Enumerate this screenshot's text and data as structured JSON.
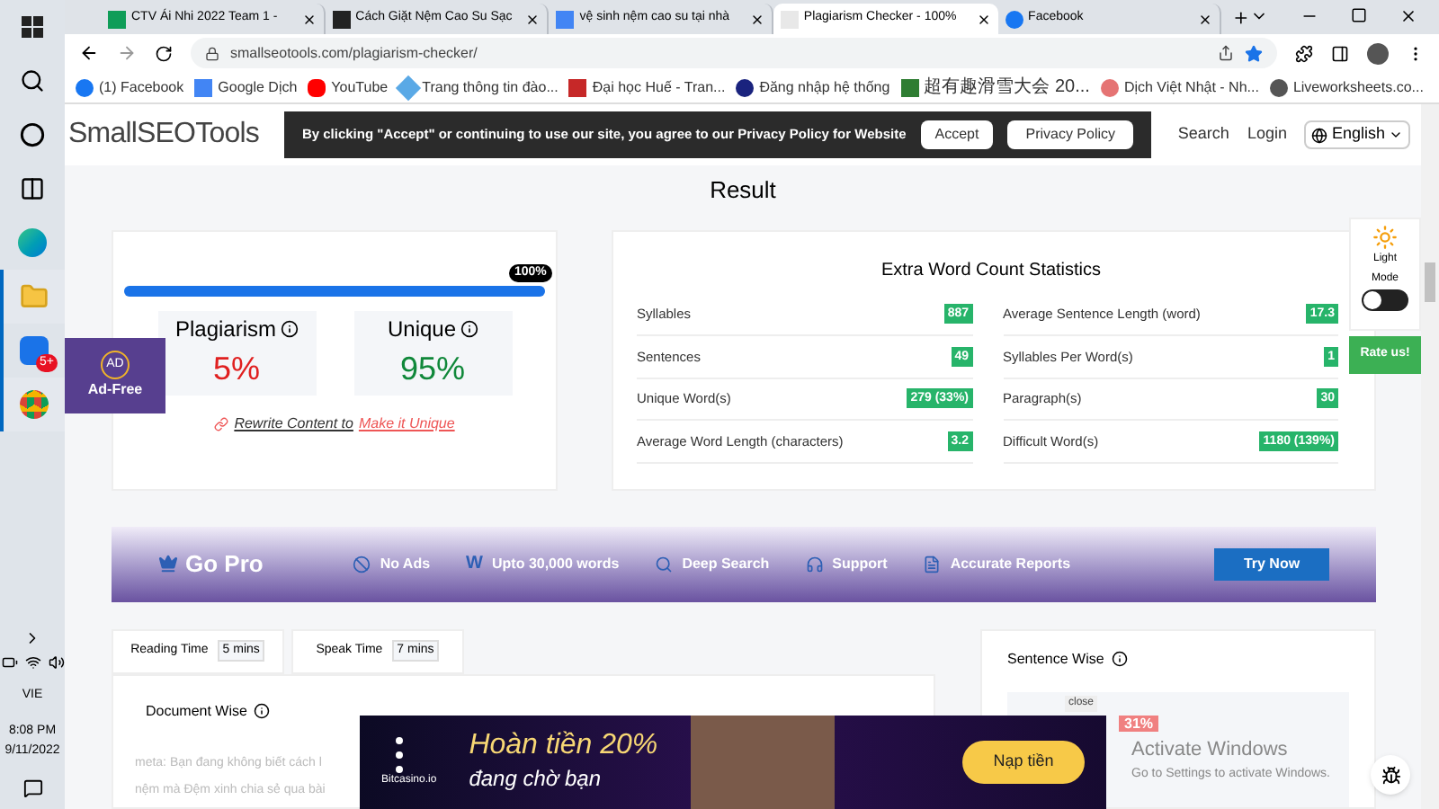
{
  "taskbar": {
    "badge": "5+",
    "language": "VIE",
    "time": "8:08 PM",
    "date": "9/11/2022"
  },
  "tabs": [
    {
      "title": "CTV Ái Nhi 2022 Team 1 -",
      "kind": "sheets",
      "selected": false
    },
    {
      "title": "Cách Giặt Nệm Cao Su Sạc",
      "kind": "dark",
      "selected": false
    },
    {
      "title": "vệ sinh nệm cao su tại nhà",
      "kind": "docs",
      "selected": false
    },
    {
      "title": "Plagiarism Checker - 100%",
      "kind": "sst",
      "selected": true
    },
    {
      "title": "Facebook",
      "kind": "facebook",
      "selected": false
    }
  ],
  "address": "smallseotools.com/plagiarism-checker/",
  "bookmarks": [
    {
      "label": "(1) Facebook",
      "kind": "facebook"
    },
    {
      "label": "Google Dịch",
      "kind": "translate"
    },
    {
      "label": "YouTube",
      "kind": "youtube"
    },
    {
      "label": "Trang thông tin đào...",
      "kind": "diamond"
    },
    {
      "label": "Đại học Huế - Tran...",
      "kind": "shield"
    },
    {
      "label": "Đăng nhập hệ thống",
      "kind": "b"
    },
    {
      "label": "超有趣滑雪大会 20...",
      "kind": "green"
    },
    {
      "label": "Dịch Việt Nhật - Nh...",
      "kind": "search"
    },
    {
      "label": "Liveworksheets.co...",
      "kind": "globe"
    }
  ],
  "site_header": {
    "logo": "SmallSEOTools",
    "links": [
      "Search",
      "Login"
    ],
    "language": "English"
  },
  "cookie_bar": {
    "message": "By clicking \"Accept\" or continuing to use our site, you agree to our Privacy Policy for Website",
    "buttons": [
      "Accept",
      "Privacy Policy"
    ]
  },
  "result": {
    "title": "Result",
    "progress": {
      "level": 1,
      "label": "100%"
    },
    "plagiarism": {
      "label": "Plagiarism",
      "value": "5%"
    },
    "unique": {
      "label": "Unique",
      "value": "95%"
    },
    "rewrite": "Rewrite Content to",
    "rewrite_link": "Make it Unique"
  },
  "stats": {
    "title": "Extra Word Count Statistics",
    "items": [
      {
        "label": "Syllables",
        "value": "887"
      },
      {
        "label": "Average Sentence Length (word)",
        "value": "17.3"
      },
      {
        "label": "Sentences",
        "value": "49"
      },
      {
        "label": "Syllables Per Word(s)",
        "value": "1"
      },
      {
        "label": "Unique Word(s)",
        "value": "279 (33%)"
      },
      {
        "label": "Paragraph(s)",
        "value": "30"
      },
      {
        "label": "Average Word Length (characters)",
        "value": "3.2"
      },
      {
        "label": "Difficult Word(s)",
        "value": "1180 (139%)"
      }
    ]
  },
  "ad_free": {
    "icon_text": "AD",
    "label": "Ad-Free"
  },
  "light_mode": {
    "label": "Light Mode",
    "on": false
  },
  "rate_us": "Rate us!",
  "go_pro": {
    "title": "Go Pro",
    "features": [
      {
        "kind": "ads",
        "label": "No Ads"
      },
      {
        "kind": "words",
        "icon_text": "W",
        "label": "Upto 30,000 words"
      },
      {
        "kind": "search",
        "label": "Deep Search"
      },
      {
        "kind": "support",
        "label": "Support"
      },
      {
        "kind": "reports",
        "label": "Accurate Reports"
      }
    ],
    "button": "Try Now"
  },
  "reading": [
    {
      "label": "Reading Time",
      "value": "5 mins"
    },
    {
      "label": "Speak Time",
      "value": "7 mins"
    }
  ],
  "document": {
    "title": "Document Wise",
    "text_lines": [
      "meta: Bạn đang không biết cách l",
      "nệm mà Đệm xinh chia sẻ qua bài"
    ]
  },
  "sentence": {
    "title": "Sentence Wise",
    "percent": "31%"
  },
  "ad": {
    "close": "close",
    "brand": "Bitcasino.io",
    "headline": "Hoàn tiền 20%",
    "subline": "đang chờ bạn",
    "button": "Nạp tiền"
  },
  "activation": {
    "title": "Activate Windows",
    "text": "Go to Settings to activate Windows."
  }
}
